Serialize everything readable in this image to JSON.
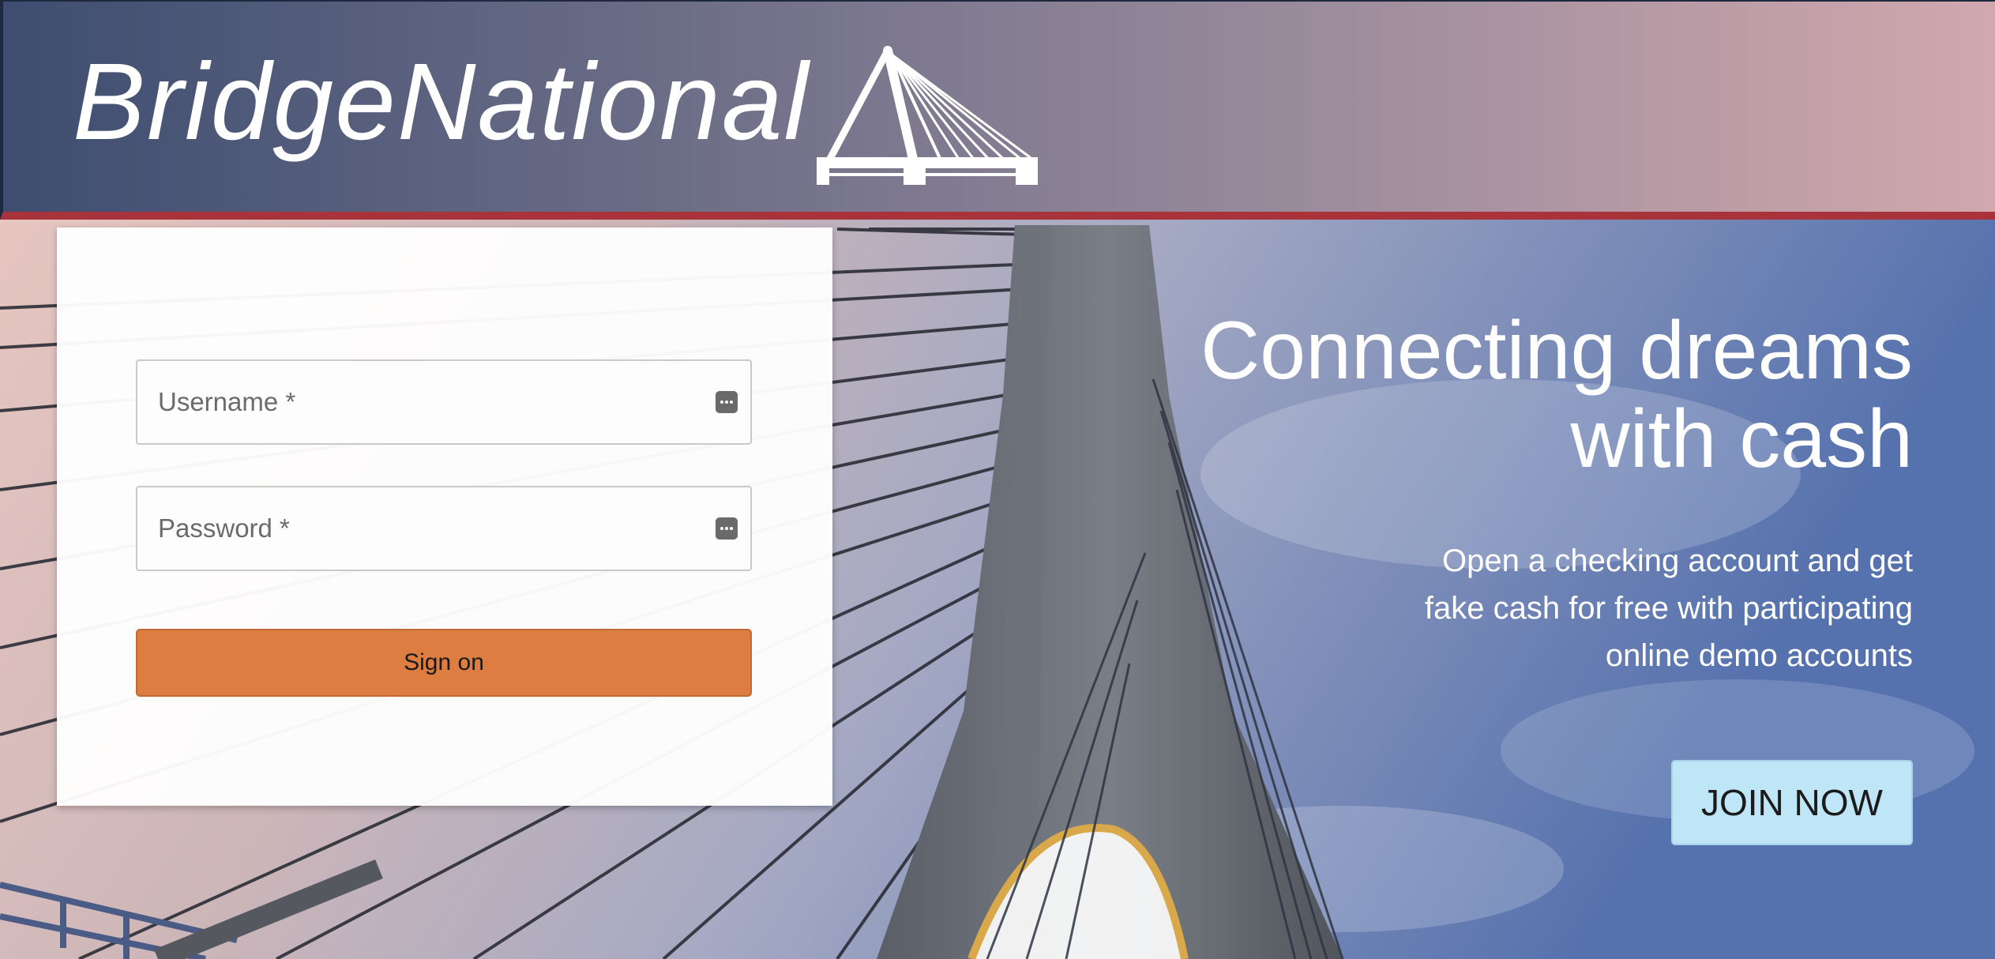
{
  "header": {
    "brand": "BridgeNational"
  },
  "login": {
    "username_placeholder": "Username *",
    "password_placeholder": "Password *",
    "signon_label": "Sign on"
  },
  "hero": {
    "title_line1": "Connecting dreams",
    "title_line2": "with cash",
    "subtitle_line1": "Open a checking account and get",
    "subtitle_line2": "fake cash for free with participating",
    "subtitle_line3": "online demo accounts",
    "join_label": "JOIN NOW"
  },
  "colors": {
    "header_accent": "#a8333b",
    "signon_button": "#dd7d41",
    "join_button": "#bfe6f7"
  },
  "icons": {
    "logo": "cable-stayed-bridge-icon",
    "field_icon": "password-manager-key-icon"
  }
}
